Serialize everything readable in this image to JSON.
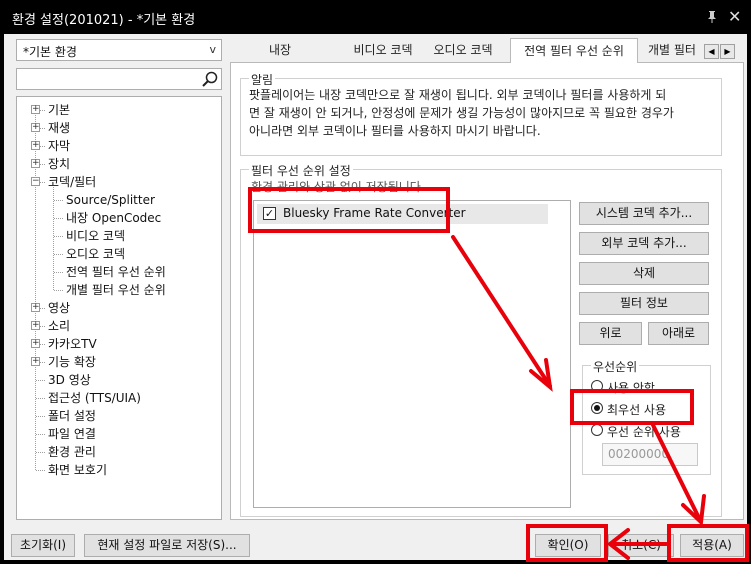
{
  "window": {
    "title": "환경 설정(201021) - *기본 환경"
  },
  "sidebar": {
    "preset": "*기본 환경",
    "search_placeholder": "",
    "tree": [
      {
        "label": "기본",
        "expander": "+"
      },
      {
        "label": "재생",
        "expander": "+"
      },
      {
        "label": "자막",
        "expander": "+"
      },
      {
        "label": "장치",
        "expander": "+"
      },
      {
        "label": "코덱/필터",
        "expander": "−"
      },
      {
        "label": "Source/Splitter"
      },
      {
        "label": "내장 OpenCodec"
      },
      {
        "label": "비디오 코덱"
      },
      {
        "label": "오디오 코덱"
      },
      {
        "label": "전역 필터 우선 순위"
      },
      {
        "label": "개별 필터 우선 순위"
      },
      {
        "label": "영상",
        "expander": "+"
      },
      {
        "label": "소리",
        "expander": "+"
      },
      {
        "label": "카카오TV",
        "expander": "+"
      },
      {
        "label": "기능 확장",
        "expander": "+"
      },
      {
        "label": "3D 영상"
      },
      {
        "label": "접근성 (TTS/UIA)"
      },
      {
        "label": "폴더 설정"
      },
      {
        "label": "파일 연결"
      },
      {
        "label": "환경 관리"
      },
      {
        "label": "화면 보호기"
      }
    ]
  },
  "tabs": [
    "내장 OpenCodec",
    "비디오 코덱",
    "오디오 코덱",
    "전역 필터 우선 순위",
    "개별 필터"
  ],
  "tab_scroll": {
    "left": "◀",
    "right": "▶"
  },
  "notice": {
    "title": "알림",
    "lines": [
      "팟플레이어는 내장 코덱만으로 잘 재생이 됩니다. 외부 코덱이나 필터를 사용하게 되",
      "면 잘 재생이 안 되거나, 안정성에 문제가 생길 가능성이 많아지므로 꼭 필요한 경우가",
      "아니라면 외부 코덱이나 필터를 사용하지 마시기 바랍니다."
    ]
  },
  "filter_priority": {
    "title": "필터 우선 순위 설정",
    "subtitle": "환경 관리와 상관 없이 저장됩니다",
    "items": [
      {
        "label": "Bluesky Frame Rate Converter",
        "checked": "✓"
      }
    ],
    "buttons": {
      "add_system": "시스템 코덱 추가...",
      "add_external": "외부 코덱 추가...",
      "delete": "삭제",
      "filter_info": "필터 정보",
      "up": "위로",
      "down": "아래로"
    },
    "priority_group": {
      "title": "우선순위",
      "options": [
        "사용 안함",
        "최우선 사용",
        "우선 순위 사용"
      ],
      "selected": "최우선 사용",
      "value": "00200000"
    }
  },
  "footer": {
    "reset": "초기화(I)",
    "save_current": "현재 설정 파일로 저장(S)...",
    "ok": "확인(O)",
    "cancel": "취소(C)",
    "apply": "적용(A)"
  },
  "annotation_color": "#e8000b"
}
